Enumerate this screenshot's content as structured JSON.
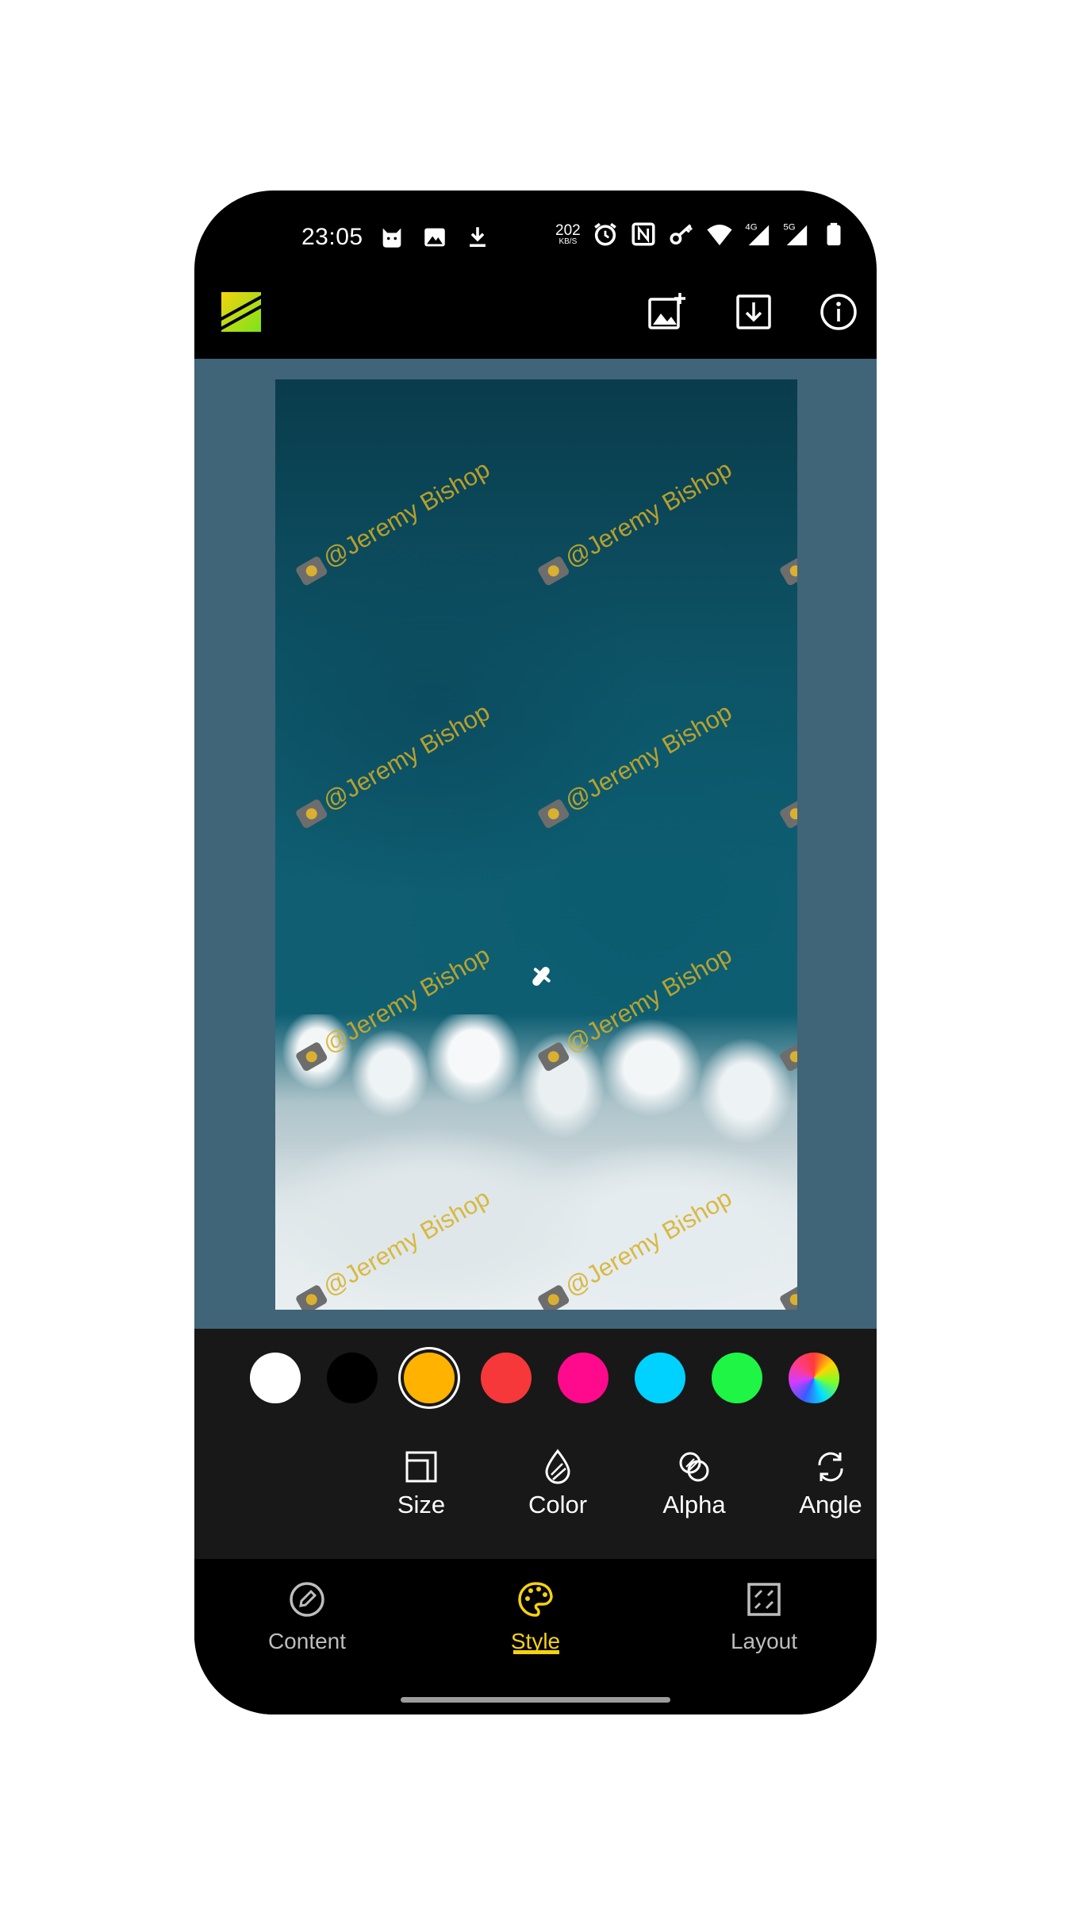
{
  "status_bar": {
    "time": "23:05",
    "net_speed_value": "202",
    "net_speed_unit": "KB/S",
    "icons_left": [
      "cat-icon",
      "image-icon",
      "download-icon"
    ],
    "icons_right": [
      "alarm-icon",
      "nfc-icon",
      "key-icon",
      "wifi-icon",
      "signal-4g-icon",
      "signal-5g-icon",
      "battery-icon"
    ],
    "signal_labels": [
      "4G",
      "5G"
    ]
  },
  "app_bar": {
    "logo": "app-logo",
    "actions": [
      "add-image-icon",
      "save-icon",
      "info-icon"
    ]
  },
  "preview": {
    "background_color": "#406478",
    "watermark_text": "@Jeremy Bishop"
  },
  "colors": [
    {
      "hex": "#ffffff",
      "selected": false
    },
    {
      "hex": "#000000",
      "selected": false
    },
    {
      "hex": "#ffb300",
      "selected": true
    },
    {
      "hex": "#f6383a",
      "selected": false
    },
    {
      "hex": "#ff0a8c",
      "selected": false
    },
    {
      "hex": "#00d2ff",
      "selected": false
    },
    {
      "hex": "#1ef545",
      "selected": false
    },
    {
      "hex": "rainbow",
      "selected": false
    }
  ],
  "tools": [
    {
      "label": "Size",
      "icon": "size-icon"
    },
    {
      "label": "Color",
      "icon": "droplet-icon"
    },
    {
      "label": "Alpha",
      "icon": "alpha-icon"
    },
    {
      "label": "Angle",
      "icon": "rotate-icon"
    }
  ],
  "nav": [
    {
      "label": "Content",
      "icon": "edit-circle-icon",
      "active": false
    },
    {
      "label": "Style",
      "icon": "palette-icon",
      "active": true
    },
    {
      "label": "Layout",
      "icon": "layout-grid-icon",
      "active": false
    }
  ],
  "accent_color": "#f5d20f"
}
